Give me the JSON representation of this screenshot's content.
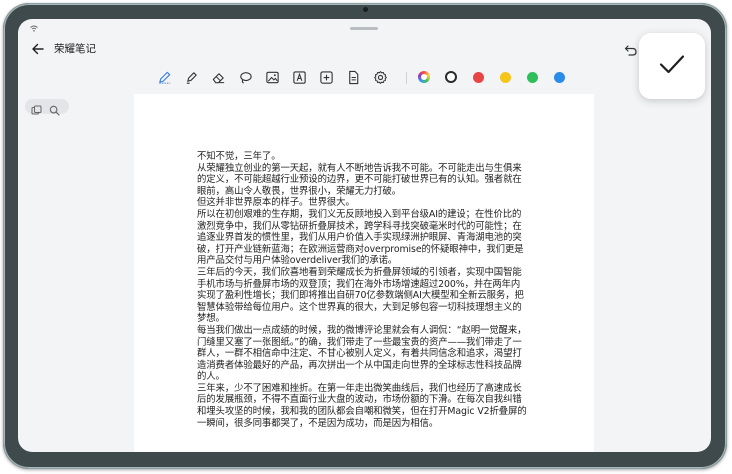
{
  "app": {
    "title": "荣耀笔记"
  },
  "icons": {
    "back": "arrow-left-icon",
    "undo": "undo-icon",
    "confirm": "checkmark-icon",
    "tools": [
      "pen-icon",
      "highlighter-icon",
      "eraser-icon",
      "lasso-icon",
      "image-icon",
      "text-box-icon",
      "add-icon",
      "document-icon",
      "settings-icon"
    ],
    "mini": [
      "page-thumbnail-icon",
      "search-icon"
    ]
  },
  "colors": {
    "accent": "#3b7de1",
    "palette": [
      "#2b2b2b",
      "#e84545",
      "#f5c518",
      "#2fbf5a",
      "#2b8be8"
    ]
  },
  "document": {
    "paragraphs": [
      "不知不觉，三年了。",
      "从荣耀独立创业的第一天起，就有人不断地告诉我不可能。不可能走出与生俱来的定义，不可能超越行业预设的边界，更不可能打破世界已有的认知。强者就在眼前，高山令人敬畏，世界很小，荣耀无力打破。",
      "但这并非世界原本的样子。世界很大。",
      "所以在初创艰难的生存期，我们义无反顾地投入到平台级AI的建设；在性价比的激烈竞争中，我们从零钻研折叠屏技术，跨学科寻找突破毫米时代的可能性；在追逐业界首发的惯性里，我们从用户价值入手实现绿洲护眼屏、青海湖电池的突破，打开产业链新蓝海；在欧洲运营商对overpromise的怀疑眼神中，我们更是用产品交付与用户体验overdeliver我们的承诺。",
      "三年后的今天，我们欣喜地看到荣耀成长为折叠屏领域的引领者，实现中国智能手机市场与折叠屏市场的双登顶；我们在海外市场增速超过200%，并在两年内实现了盈利性增长；我们即将推出自研70亿参数端侧AI大模型和全新云服务，把智慧体验带给每位用户。这个世界真的很大，大到足够包容一切科技理想主义的梦想。",
      "每当我们做出一点成绩的时候，我的微博评论里就会有人调侃：“赵明一觉醒来，门缝里又塞了一张图纸。”的确，我们带走了一些最宝贵的资产——我们带走了一群人，一群不相信命中注定、不甘心被别人定义，有着共同信念和追求，渴望打造消费者体验最好的产品，再次拼出一个从中国走向世界的全球标志性科技品牌的人。",
      "三年来，少不了困难和挫折。在第一年走出微笑曲线后，我们也经历了高速成长后的发展瓶颈，不得不直面行业大盘的波动，市场份额的下滑。在每次自我纠错和埋头攻坚的时候，我和我的团队都会自嘲和微笑，但在打开Magic V2折叠屏的一瞬间，很多同事都哭了，不是因为成功，而是因为相信。"
    ]
  }
}
